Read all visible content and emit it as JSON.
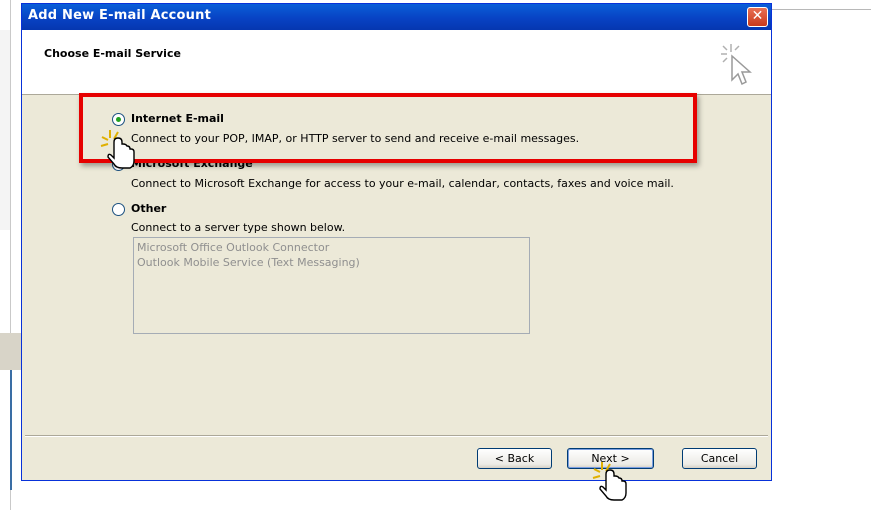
{
  "dialog": {
    "title": "Add New E-mail Account",
    "close_label": "✕",
    "header_title": "Choose E-mail Service"
  },
  "options": [
    {
      "title": "Internet E-mail",
      "description": "Connect to your POP, IMAP, or HTTP server to send and receive e-mail messages.",
      "selected": true
    },
    {
      "title": "Microsoft Exchange",
      "description": "Connect to Microsoft Exchange for access to your e-mail, calendar, contacts, faxes and voice mail.",
      "selected": false
    },
    {
      "title": "Other",
      "description": "Connect to a server type shown below.",
      "selected": false
    }
  ],
  "other_list": {
    "items": [
      "Microsoft Office Outlook Connector",
      "Outlook Mobile Service (Text Messaging)"
    ]
  },
  "buttons": {
    "back": "< Back",
    "next": "Next >",
    "cancel": "Cancel"
  },
  "colors": {
    "titlebar": "#0842c4",
    "dialog_bg": "#ece9d8",
    "highlight": "#e60000",
    "radio_dot": "#21a121"
  },
  "icons": [
    "wizard-cursor-icon",
    "hand-pointer-icon"
  ]
}
